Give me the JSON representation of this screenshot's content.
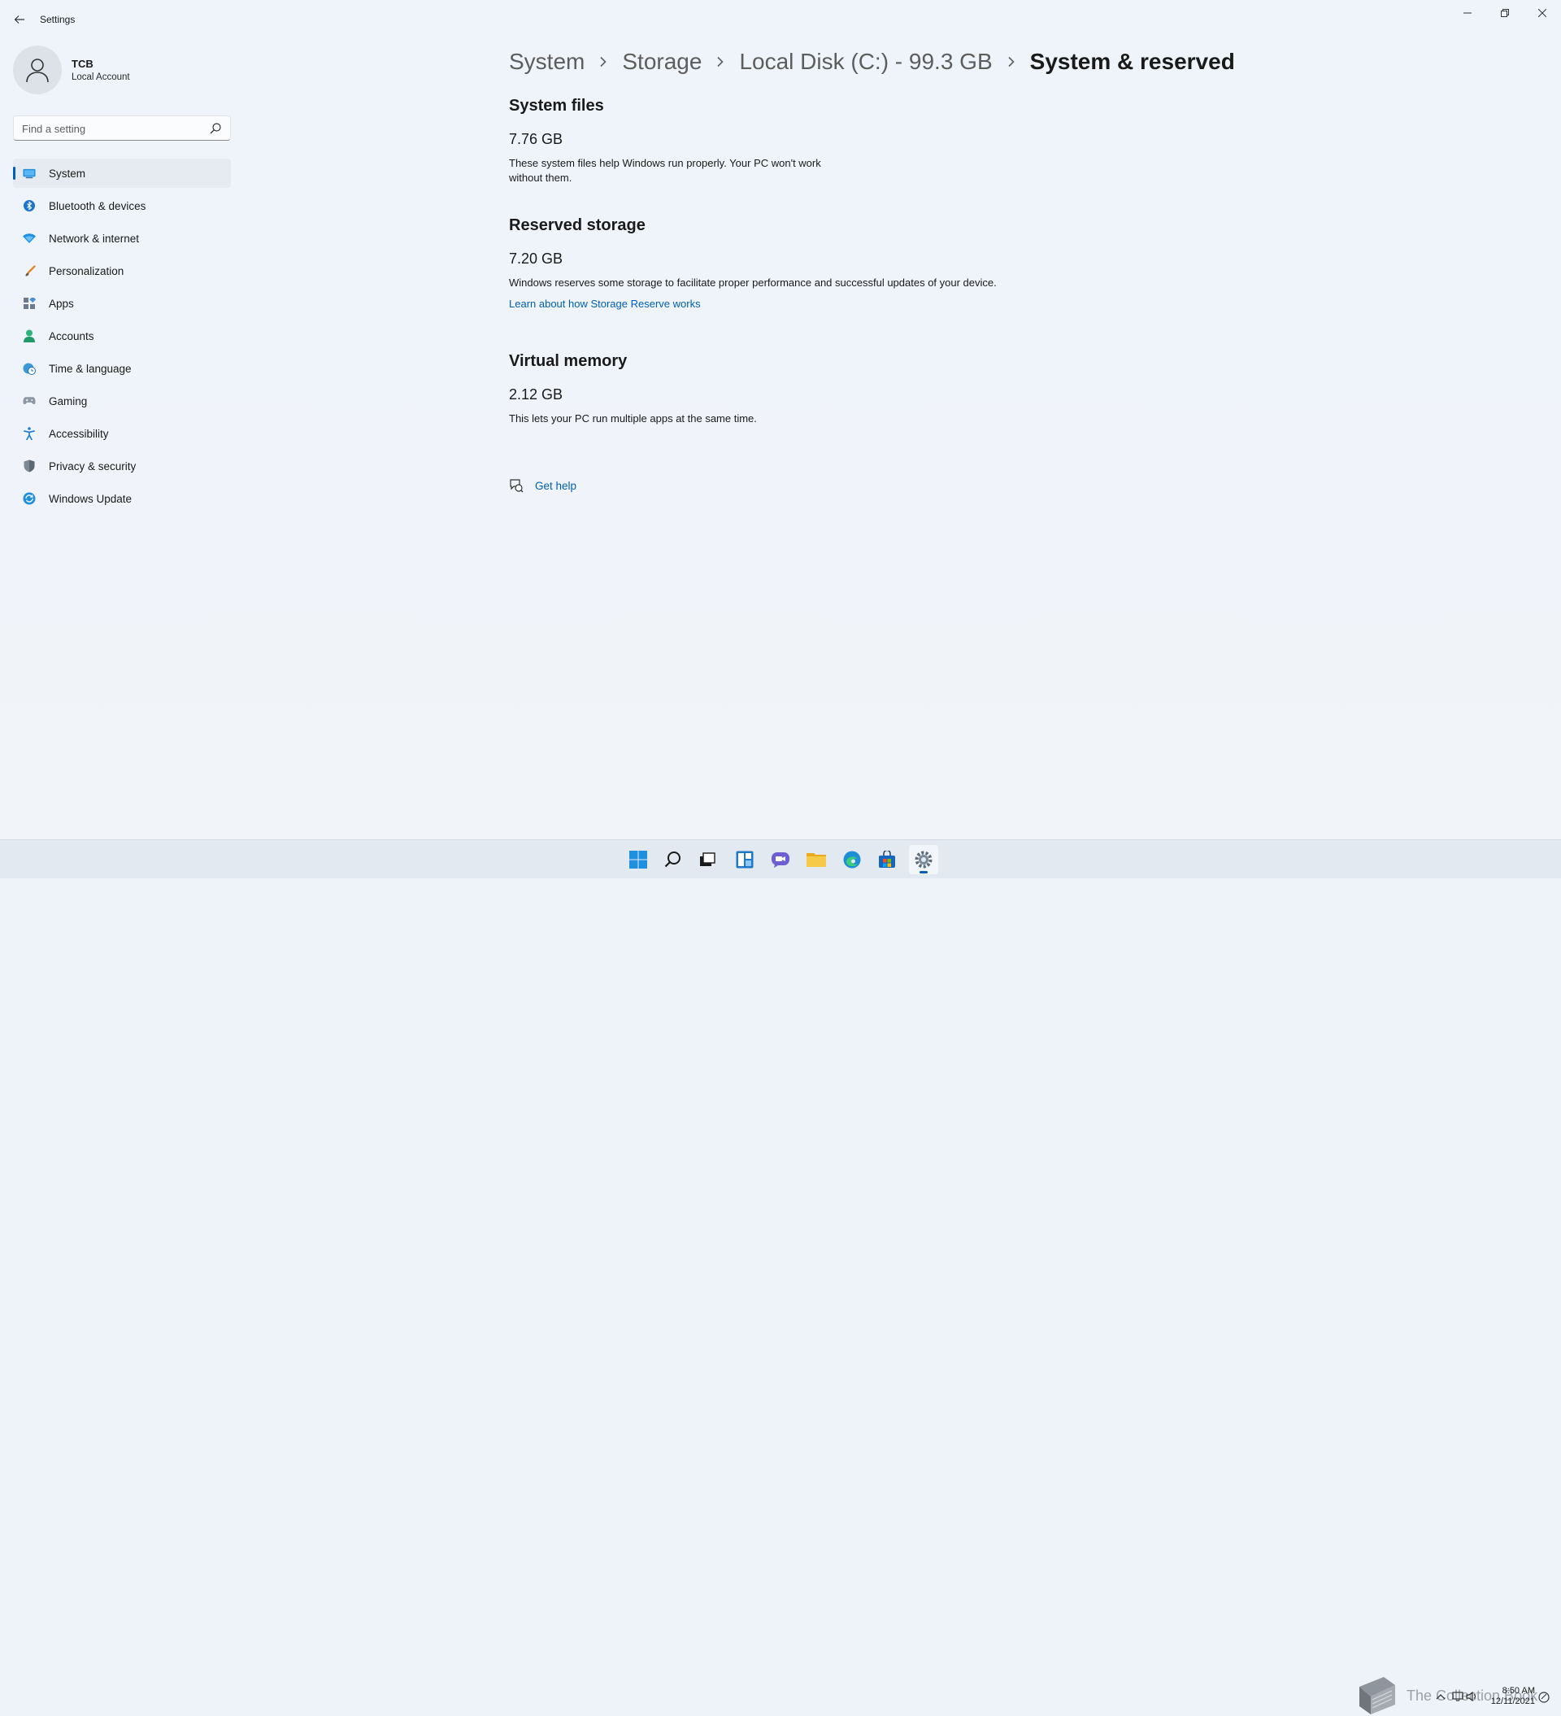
{
  "window": {
    "title": "Settings",
    "profile": {
      "name": "TCB",
      "account_type": "Local Account"
    },
    "search": {
      "placeholder": "Find a setting"
    }
  },
  "sidebar": {
    "items": [
      {
        "label": "System",
        "icon": "system-icon",
        "active": true
      },
      {
        "label": "Bluetooth & devices",
        "icon": "bluetooth-icon"
      },
      {
        "label": "Network & internet",
        "icon": "wifi-icon"
      },
      {
        "label": "Personalization",
        "icon": "brush-icon"
      },
      {
        "label": "Apps",
        "icon": "apps-icon"
      },
      {
        "label": "Accounts",
        "icon": "accounts-icon"
      },
      {
        "label": "Time & language",
        "icon": "globe-clock-icon"
      },
      {
        "label": "Gaming",
        "icon": "gamepad-icon"
      },
      {
        "label": "Accessibility",
        "icon": "accessibility-icon"
      },
      {
        "label": "Privacy & security",
        "icon": "shield-icon"
      },
      {
        "label": "Windows Update",
        "icon": "update-icon"
      }
    ]
  },
  "breadcrumb": [
    "System",
    "Storage",
    "Local Disk (C:) - 99.3 GB",
    "System & reserved"
  ],
  "sections": {
    "system_files": {
      "title": "System files",
      "size": "7.76 GB",
      "description": "These system files help Windows run properly. Your PC won't work without them."
    },
    "reserved_storage": {
      "title": "Reserved storage",
      "size": "7.20 GB",
      "description": "Windows reserves some storage to facilitate proper performance and successful updates of your device.",
      "link": "Learn about how Storage Reserve works"
    },
    "virtual_memory": {
      "title": "Virtual memory",
      "size": "2.12 GB",
      "description": "This lets your PC run multiple apps at the same time."
    }
  },
  "help": {
    "label": "Get help"
  },
  "taskbar": {
    "apps": [
      "start-icon",
      "search-icon",
      "task-view-icon",
      "widgets-icon",
      "chat-icon",
      "file-explorer-icon",
      "edge-icon",
      "store-icon",
      "settings-icon"
    ],
    "watermark": "The Collection Book",
    "time": "8:50 AM",
    "date": "12/11/2021"
  },
  "colors": {
    "accent": "#005fb8",
    "background": "#eef3f9"
  }
}
